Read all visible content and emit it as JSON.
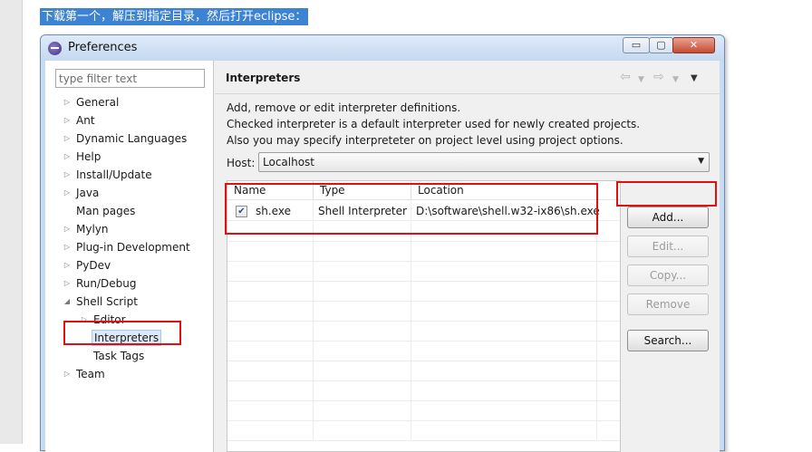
{
  "caption": "下载第一个，解压到指定目录，然后打开eclipse：",
  "window": {
    "title": "Preferences",
    "controls": {
      "minimize": "▭",
      "maximize": "▢",
      "close": "✕"
    }
  },
  "sidebar": {
    "filter_placeholder": "type filter text",
    "items": [
      {
        "label": "General",
        "twisty": "▷"
      },
      {
        "label": "Ant",
        "twisty": "▷"
      },
      {
        "label": "Dynamic Languages",
        "twisty": "▷"
      },
      {
        "label": "Help",
        "twisty": "▷"
      },
      {
        "label": "Install/Update",
        "twisty": "▷"
      },
      {
        "label": "Java",
        "twisty": "▷"
      },
      {
        "label": "Man pages",
        "twisty": ""
      },
      {
        "label": "Mylyn",
        "twisty": "▷"
      },
      {
        "label": "Plug-in Development",
        "twisty": "▷"
      },
      {
        "label": "PyDev",
        "twisty": "▷"
      },
      {
        "label": "Run/Debug",
        "twisty": "▷"
      },
      {
        "label": "Shell Script",
        "twisty": "◢"
      },
      {
        "label": "Editor",
        "twisty": "▷"
      },
      {
        "label": "Interpreters",
        "twisty": ""
      },
      {
        "label": "Task Tags",
        "twisty": ""
      },
      {
        "label": "Team",
        "twisty": "▷"
      }
    ]
  },
  "page": {
    "title": "Interpreters",
    "nav": {
      "back": "⇦",
      "forward": "⇨",
      "dropdown": "▼"
    },
    "description": [
      "Add, remove or edit interpreter definitions.",
      "Checked interpreter is a default interpreter used for newly created projects.",
      "Also you may specify interpreteter on project level using project options."
    ],
    "host_label": "Host:",
    "host_value": "Localhost",
    "select_arrow": "▼"
  },
  "table": {
    "columns": [
      "Name",
      "Type",
      "Location"
    ],
    "rows": [
      {
        "checked": "✔",
        "name": "sh.exe",
        "type": "Shell Interpreter",
        "location": "D:\\software\\shell.w32-ix86\\sh.exe"
      }
    ]
  },
  "buttons": {
    "add": "Add...",
    "edit": "Edit...",
    "copy": "Copy...",
    "remove": "Remove",
    "search": "Search..."
  },
  "colors": {
    "highlight": "#e01010",
    "caption_bg": "#3c83d4",
    "selection": "#dceaf8"
  }
}
